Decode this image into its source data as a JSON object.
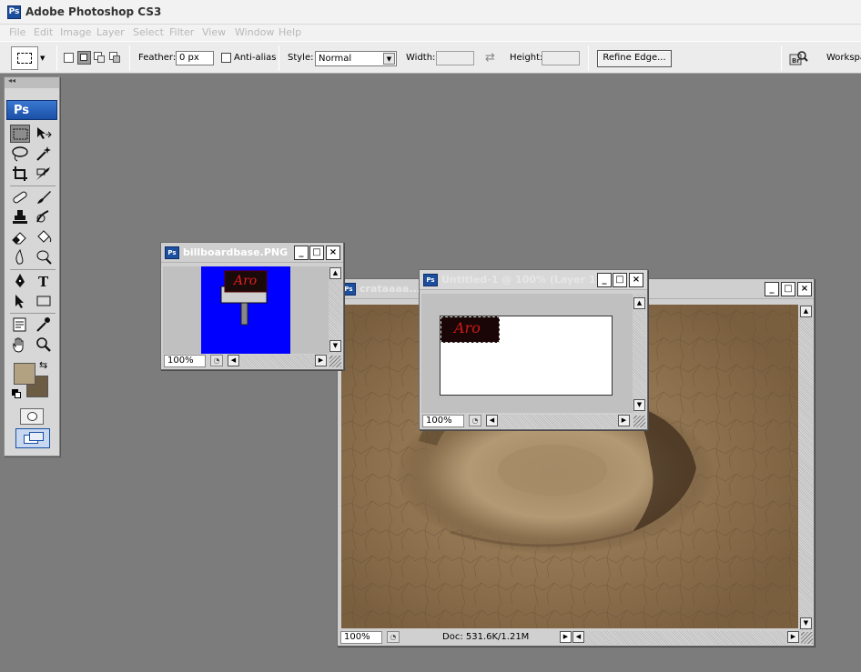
{
  "app": {
    "title": "Adobe Photoshop CS3",
    "icon_text": "Ps"
  },
  "menubar": {
    "items": [
      "File",
      "Edit",
      "Image",
      "Layer",
      "Select",
      "Filter",
      "View",
      "Window",
      "Help"
    ]
  },
  "options_bar": {
    "feather_label": "Feather:",
    "feather_value": "0 px",
    "antialias_label": "Anti-alias",
    "style_label": "Style:",
    "style_value": "Normal",
    "width_label": "Width:",
    "height_label": "Height:",
    "refine_edge_label": "Refine Edge...",
    "workspace_label": "Workspace"
  },
  "toolbox": {
    "logo": "Ps",
    "foreground_color": "#b3a282",
    "background_color": "#6c5c44"
  },
  "documents": {
    "billboard": {
      "name": "billboardbase.PNG ...",
      "zoom": "100%",
      "icon_text": "Ps",
      "sign_text": "Aro"
    },
    "untitled": {
      "name": "Untitled-1 @ 100% (Layer 1...",
      "zoom": "100%",
      "icon_text": "Ps",
      "sign_text": "Aro"
    },
    "crater": {
      "name": "crataaaa...",
      "zoom": "100%",
      "doc_info": "Doc: 531.6K/1.21M",
      "icon_text": "Ps"
    }
  },
  "window_buttons": {
    "minimize": "_",
    "maximize": "□",
    "close": "×"
  }
}
